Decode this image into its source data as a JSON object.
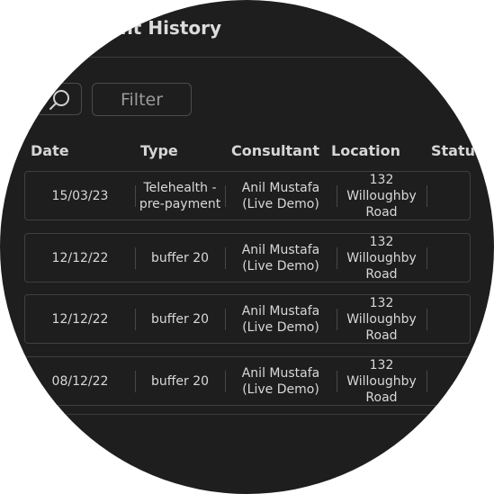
{
  "header": {
    "title": "ent History"
  },
  "toolbar": {
    "filter_placeholder": "Filter",
    "search_icon": "search-icon"
  },
  "table": {
    "columns": [
      "Date",
      "Type",
      "Consultant",
      "Location",
      "Status"
    ],
    "rows": [
      {
        "date": "15/03/23",
        "type": "Telehealth - pre-payment",
        "consultant": "Anil Mustafa (Live Demo)",
        "location": "132 Willoughby Road"
      },
      {
        "date": "12/12/22",
        "type": "buffer 20",
        "consultant": "Anil Mustafa (Live Demo)",
        "location": "132 Willoughby Road"
      },
      {
        "date": "12/12/22",
        "type": "buffer 20",
        "consultant": "Anil Mustafa (Live Demo)",
        "location": "132 Willoughby Road"
      },
      {
        "date": "08/12/22",
        "type": "buffer 20",
        "consultant": "Anil Mustafa (Live Demo)",
        "location": "132 Willoughby Road"
      }
    ]
  },
  "colors": {
    "background": "#1e1e1e",
    "text": "#d8d8d8",
    "border": "#3f3f3f"
  }
}
